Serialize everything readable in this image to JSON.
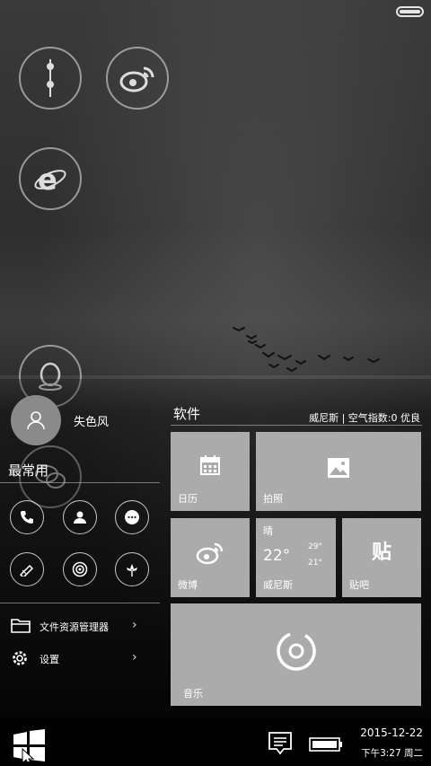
{
  "desktop": {
    "icons": [
      {
        "name": "phone-app-icon"
      },
      {
        "name": "weibo-icon"
      },
      {
        "name": "internet-explorer-icon"
      },
      {
        "name": "qq-icon"
      },
      {
        "name": "wechat-icon"
      }
    ]
  },
  "start_menu": {
    "user": {
      "name": "失色风"
    },
    "most_used_title": "最常用",
    "quick_actions": [
      {
        "icon": "phone-icon"
      },
      {
        "icon": "contacts-icon"
      },
      {
        "icon": "messages-icon"
      },
      {
        "icon": "paintbrush-icon"
      },
      {
        "icon": "camera-lens-icon"
      },
      {
        "icon": "flower-icon"
      }
    ],
    "list": [
      {
        "label": "文件资源管理器",
        "icon": "folder-icon"
      },
      {
        "label": "设置",
        "icon": "gear-icon"
      }
    ]
  },
  "tiles": {
    "header": "软件",
    "weather_meta": "威尼斯 | 空气指数:0 优良",
    "calendar": {
      "label": "日历"
    },
    "photo": {
      "label": "拍照"
    },
    "weibo": {
      "label": "微博"
    },
    "weather": {
      "condition": "晴",
      "temp": "22°",
      "high": "29°",
      "low": "21°",
      "city": "威尼斯"
    },
    "tieba": {
      "glyph": "贴",
      "label": "贴吧"
    },
    "music": {
      "label": "音乐"
    }
  },
  "taskbar": {
    "date": "2015-12-22",
    "time": "下午3:27 周二"
  }
}
